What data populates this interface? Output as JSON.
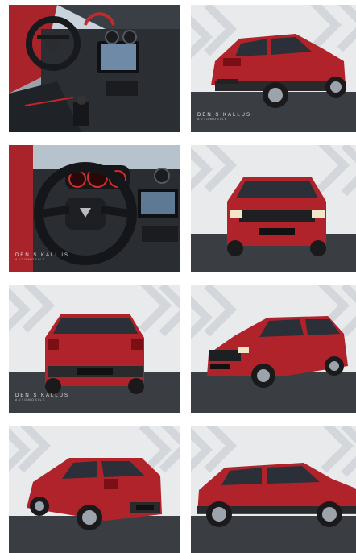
{
  "gallery": {
    "photos": [
      {
        "label": "interior-dashboard-left-view",
        "watermark": ""
      },
      {
        "label": "rear-three-quarter-view",
        "watermark": "DENIS KALLUS"
      },
      {
        "label": "steering-wheel-instrument-cluster",
        "watermark": "DENIS KALLUS"
      },
      {
        "label": "front-view",
        "watermark": ""
      },
      {
        "label": "rear-view",
        "watermark": "DENIS KALLUS"
      },
      {
        "label": "front-three-quarter-view",
        "watermark": ""
      },
      {
        "label": "rear-left-three-quarter-view",
        "watermark": ""
      },
      {
        "label": "side-profile-view",
        "watermark": ""
      }
    ],
    "watermark_sub": "AUTOMOBILE",
    "car_color": "#b0232b",
    "studio_wall_color": "#e9eaec",
    "floor_color": "#3a3d42"
  }
}
